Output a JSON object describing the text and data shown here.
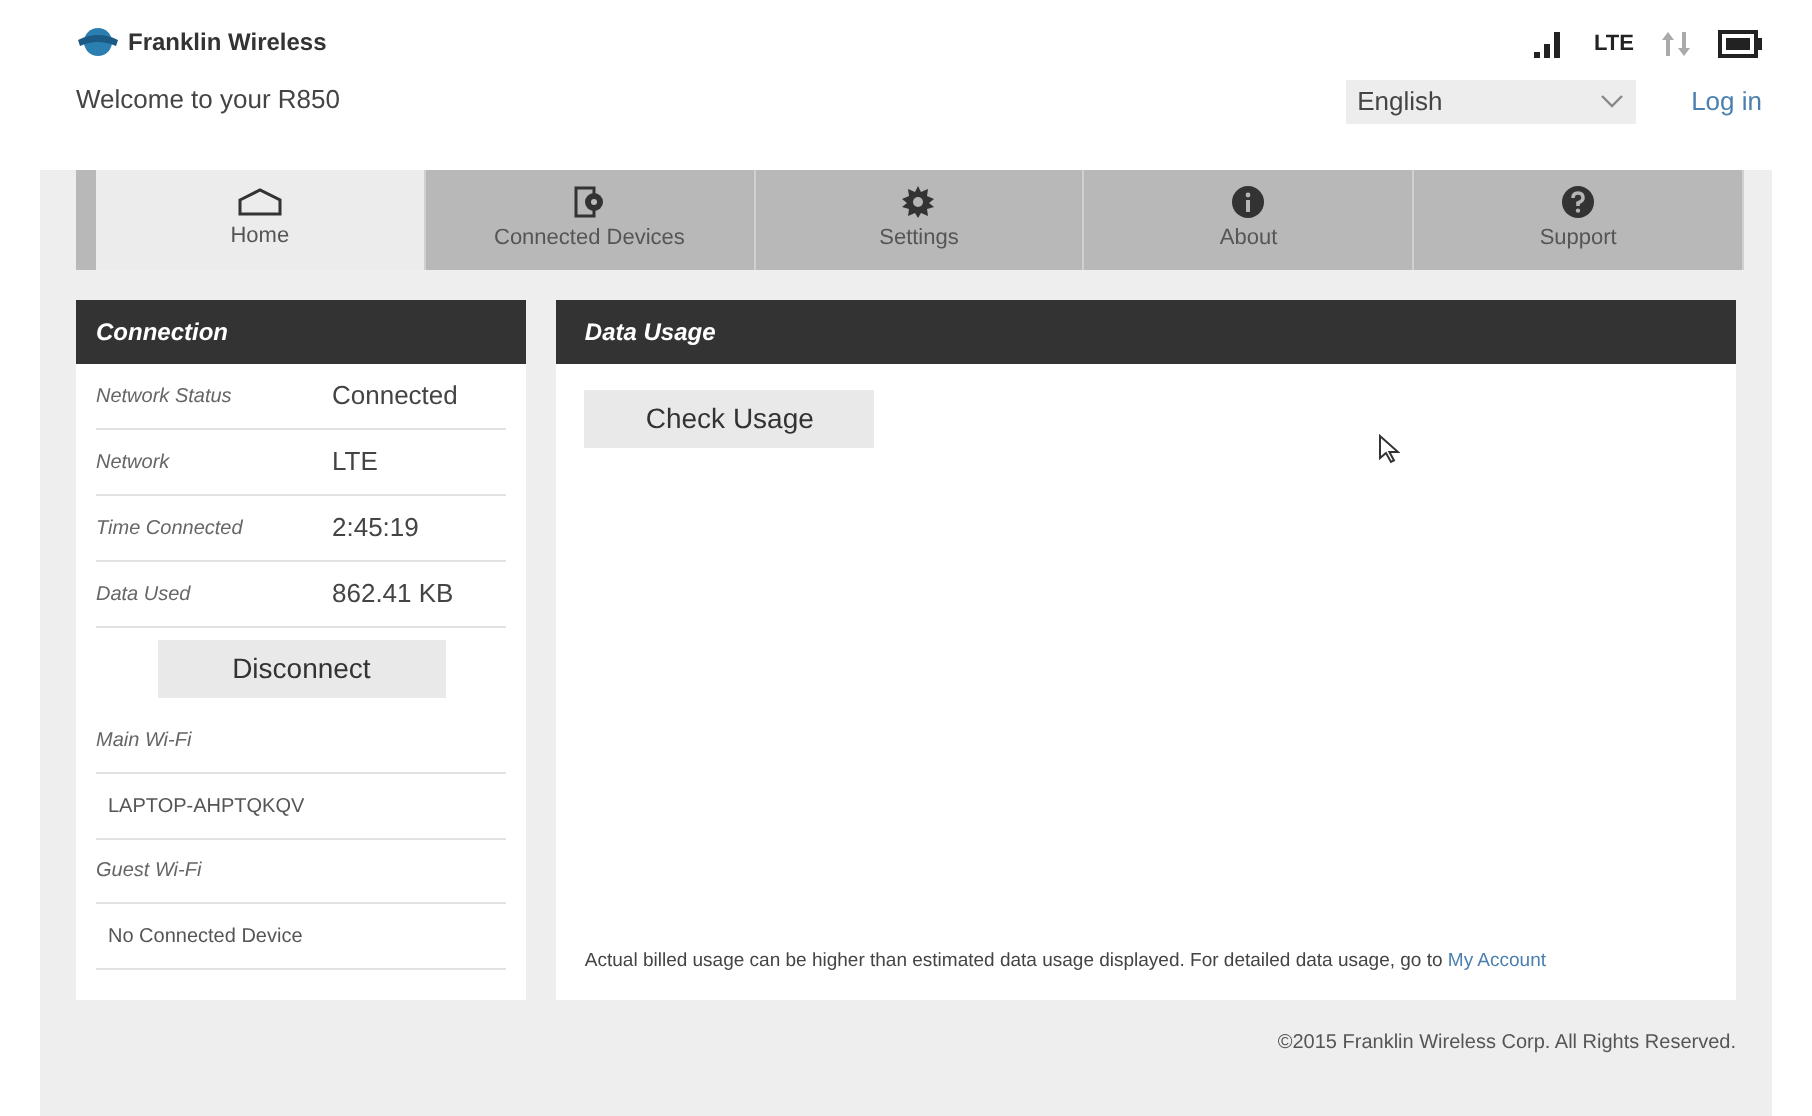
{
  "header": {
    "brand": "Franklin Wireless",
    "welcome": "Welcome to your R850",
    "status": {
      "network_type": "LTE"
    },
    "language": "English",
    "login": "Log in"
  },
  "tabs": [
    {
      "label": "Home",
      "kind": "home",
      "selected": true
    },
    {
      "label": "Connected Devices",
      "kind": "device",
      "selected": false
    },
    {
      "label": "Settings",
      "kind": "gear",
      "selected": false
    },
    {
      "label": "About",
      "kind": "info",
      "selected": false
    },
    {
      "label": "Support",
      "kind": "help",
      "selected": false
    }
  ],
  "connection": {
    "title": "Connection",
    "rows": [
      {
        "label": "Network Status",
        "value": "Connected"
      },
      {
        "label": "Network",
        "value": "LTE"
      },
      {
        "label": "Time Connected",
        "value": "2:45:19"
      },
      {
        "label": "Data Used",
        "value": "862.41 KB"
      }
    ],
    "button": "Disconnect",
    "wifi": [
      {
        "label": "Main Wi-Fi",
        "device": "LAPTOP-AHPTQKQV"
      },
      {
        "label": "Guest Wi-Fi",
        "device": "No Connected Device"
      }
    ]
  },
  "data_usage": {
    "title": "Data Usage",
    "button": "Check Usage",
    "note": "Actual billed usage can be higher than estimated data usage displayed. For detailed data usage, go to",
    "link": "My Account"
  },
  "footer": "©2015 Franklin Wireless Corp. All Rights Reserved."
}
